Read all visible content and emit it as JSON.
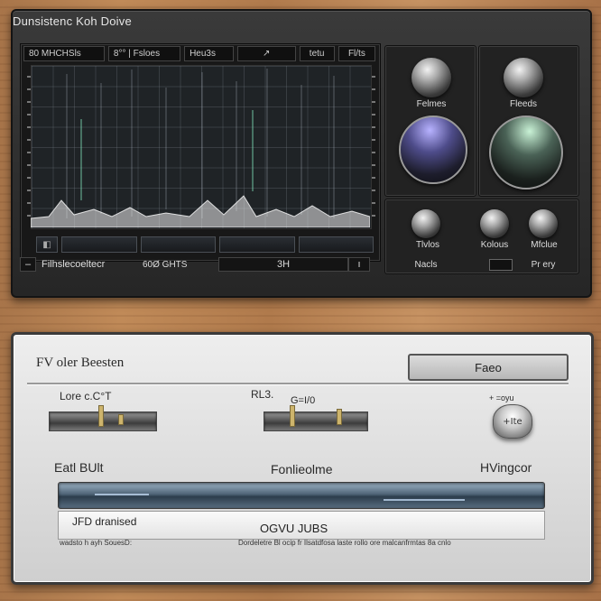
{
  "top": {
    "title": "Dunsistenc Koh Doive",
    "toolbar": [
      "80 MHCHSls",
      "8°° | Fsloes",
      "Heu3s",
      "↗",
      "tetu",
      "Fl/ts"
    ],
    "scope_buttons": [
      "",
      "",
      "",
      ""
    ],
    "status": {
      "left": "Filhslecoeltecr",
      "middle": "60Ø GHTS",
      "value": "3H"
    },
    "knobs": {
      "top_left_label": "Felmes",
      "top_right_label": "Fleeds",
      "bottom_1_label": "Tlvlos",
      "bottom_2_label": "Kolous",
      "bottom_3_label": "Mfclue",
      "foot_left": "Nacls",
      "foot_right": "Pr ery"
    }
  },
  "bottom": {
    "title": "FV oler Beesten",
    "face_button": "Faeo",
    "slider_1_label": "Lore c.C°T",
    "slider_2_label": "RL3.",
    "slider_2_sub": "G=I/0",
    "knob_top_label": "+ =oyu",
    "knob_text": "+Ite",
    "left_label": "Eatl BUlt",
    "center_label": "Fonlieolme",
    "right_label": "HVingcor",
    "info_label": "JFD dranised",
    "info_value": "OGVU JUBS",
    "footer_left": "wadsto h ayh SouesD:",
    "footer_right": "Dordeletre Bl ocip fr Ilsatdfosa laste rollo ore malcanfrmtas 8a cnlo"
  }
}
